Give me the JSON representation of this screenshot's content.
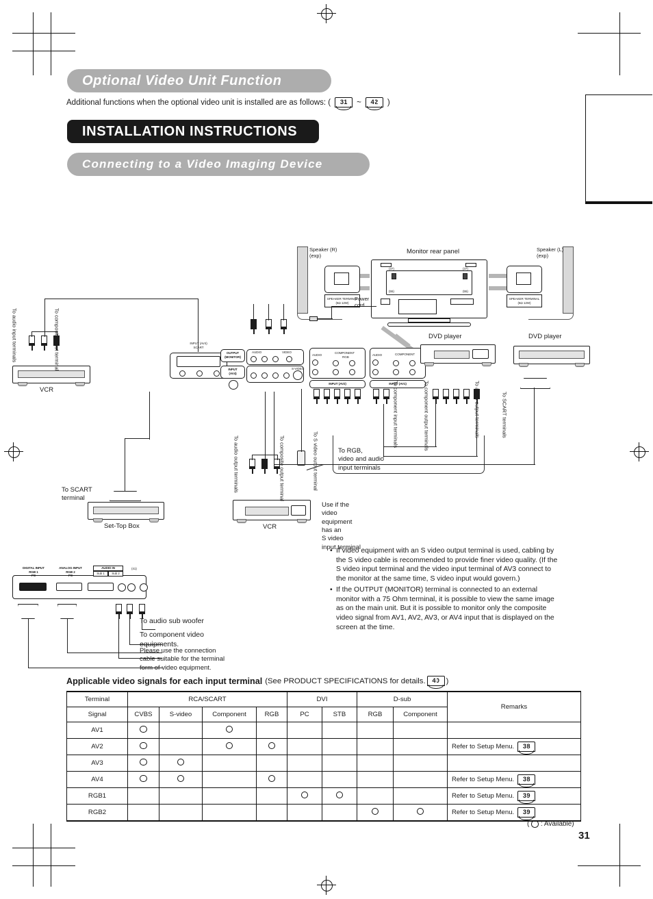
{
  "headings": {
    "optional": "Optional Video Unit Function",
    "installation": "INSTALLATION INSTRUCTIONS",
    "connecting": "Connecting to a Video Imaging Device"
  },
  "intro": {
    "text_before": "Additional functions when the optional video unit is installed are as follows: (",
    "page_from": "31",
    "tilde": "~",
    "page_to": "42",
    "text_after": ")"
  },
  "diagram": {
    "speaker_right": "Speaker (R)\n(exp)",
    "speaker_left": "Speaker (L)\n(exp)",
    "monitor_rear_panel": "Monitor rear panel",
    "speaker_terminal": "SPEAKER TERMINAL\n(6Ω 12W)",
    "power_cord": "Power\ncord",
    "ref_37_left": "(37)",
    "ref_37_right": "(37)",
    "ref_55_left": "(55)",
    "ref_55_right": "(55)",
    "vcr_top": "VCR",
    "vcr_bottom": "VCR",
    "set_top_box": "Set-Top Box",
    "dvd_player_1": "DVD player",
    "dvd_player_2": "DVD player",
    "terminal_input_av4_scart": "INPUT (AV4)\nSCART",
    "terminal_output_monitor": "OUTPUT\n(MONITOR)",
    "terminal_input_av4": "INPUT\n(AV4)",
    "terminal_input_av2": "INPUT (AV2)",
    "terminal_input_av1": "INPUT (AV1)",
    "panel_audio": "AUDIO",
    "panel_video": "VIDEO",
    "panel_svideo": "S-VIDEO",
    "panel_component": "COMPONENT",
    "panel_rgb": "RGB",
    "lbl_to_audio_input": "To audio input terminals",
    "lbl_to_composite_input": "To composite input terminal",
    "lbl_to_audio_output": "To audio output terminals",
    "lbl_to_composite_output": "To composite output terminal",
    "lbl_to_svideo_output": "To S video output terminal",
    "lbl_to_scart_terminal": "To SCART\nterminal",
    "lbl_to_scart_terminals": "To SCART terminals",
    "lbl_to_component_output": "To component output terminals",
    "lbl_to_component_input": "To component input terminals",
    "lbl_to_audio_output_2": "To audio output terminals",
    "lbl_to_rgb_video_audio": "To RGB,\nvideo and audio\ninput terminals",
    "lbl_use_if_svideo": "Use if the\nvideo\nequipment\nhas an\nS video\ninput terminal",
    "lbl_to_audio_subwoofer": "To audio sub woofer",
    "lbl_to_component_video": "To component video\nequipments.",
    "lbl_please_use": "Please use the connection\ncable suitable for the terminal\nform of video equipment.",
    "pc_panel_digital": "DIGITAL INPUT\nRGB 1\nPC",
    "pc_panel_analog": "ANALOG INPUT\nRGB 2\nPC",
    "pc_panel_audio_in": "AUDIO IN",
    "pc_panel_sub1": "Sub 1",
    "pc_panel_sub2": "Sub 2",
    "pc_panel_ref": "(41)"
  },
  "notes": [
    "If video equipment with an S video output terminal is used, cabling by the S video cable is recommended to provide finer video quality. (If the S video input terminal and the video input terminal of AV3 connect to the monitor at the same time, S video input would govern.)",
    "If the OUTPUT (MONITOR) terminal is connected to an external monitor with a 75 Ohm terminal, it is possible to view the same image as on the main unit. But it is possible to monitor only the composite video signal from AV1, AV2, AV3, or AV4 input that is displayed on the screen at the time."
  ],
  "table_section": {
    "title_bold": "Applicable video signals for each input terminal",
    "title_sub_before": "(See PRODUCT SPECIFICATIONS for details.",
    "title_page_ref": "40",
    "title_sub_after": ")",
    "group_headers": [
      {
        "label": "Terminal",
        "span": 1
      },
      {
        "label": "RCA/SCART",
        "span": 4
      },
      {
        "label": "DVI",
        "span": 2
      },
      {
        "label": "D-sub",
        "span": 2
      },
      {
        "label": "Remarks",
        "span": 1
      }
    ],
    "signal_headers": [
      "Signal",
      "CVBS",
      "S-video",
      "Component",
      "RGB",
      "PC",
      "STB",
      "RGB",
      "Component"
    ],
    "remarks_header_blank": "",
    "rows": [
      {
        "terminal": "AV1",
        "cells": [
          true,
          false,
          true,
          false,
          false,
          false,
          false,
          false
        ],
        "remark": "",
        "remark_page": ""
      },
      {
        "terminal": "AV2",
        "cells": [
          true,
          false,
          true,
          true,
          false,
          false,
          false,
          false
        ],
        "remark": "Refer to Setup Menu.",
        "remark_page": "38"
      },
      {
        "terminal": "AV3",
        "cells": [
          true,
          true,
          false,
          false,
          false,
          false,
          false,
          false
        ],
        "remark": "",
        "remark_page": ""
      },
      {
        "terminal": "AV4",
        "cells": [
          true,
          true,
          false,
          true,
          false,
          false,
          false,
          false
        ],
        "remark": "Refer to Setup Menu.",
        "remark_page": "38"
      },
      {
        "terminal": "RGB1",
        "cells": [
          false,
          false,
          false,
          false,
          true,
          true,
          false,
          false
        ],
        "remark": "Refer to Setup Menu.",
        "remark_page": "39"
      },
      {
        "terminal": "RGB2",
        "cells": [
          false,
          false,
          false,
          false,
          false,
          false,
          true,
          true
        ],
        "remark": "Refer to Setup Menu.",
        "remark_page": "39"
      }
    ],
    "availability_note_before": "(",
    "availability_note_after": ": Available)"
  },
  "footer": {
    "page_number": "31"
  }
}
